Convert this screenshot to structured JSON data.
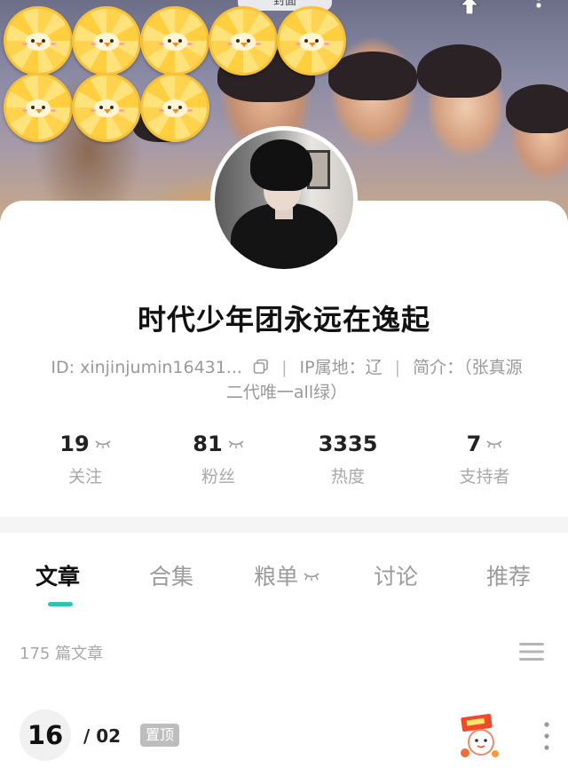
{
  "cover": {
    "tag_label": "封面",
    "candies": [
      {
        "id": "c1"
      },
      {
        "id": "c2"
      },
      {
        "id": "c3"
      },
      {
        "id": "c4"
      },
      {
        "id": "c5"
      },
      {
        "id": "c6"
      },
      {
        "id": "c7"
      },
      {
        "id": "c8"
      }
    ],
    "icons": [
      "share-icon",
      "more-vertical-icon"
    ]
  },
  "profile": {
    "name": "时代少年团永远在逸起",
    "id_label": "ID: xinjinjumin16431...",
    "ip_label": "IP属地：辽",
    "bio_label": "简介：（张真源",
    "bio_line2": "二代唯一all绿）",
    "separator": "|"
  },
  "stats": [
    {
      "value": "19",
      "label": "关注"
    },
    {
      "value": "81",
      "label": "粉丝"
    },
    {
      "value": "3335",
      "label": "热度"
    },
    {
      "value": "7",
      "label": "支持者"
    }
  ],
  "tabs": [
    {
      "label": "文章",
      "active": true
    },
    {
      "label": "合集",
      "active": false
    },
    {
      "label": "粮单",
      "active": false
    },
    {
      "label": "讨论",
      "active": false
    },
    {
      "label": "推荐",
      "active": false
    }
  ],
  "article_count": "175 篇文章",
  "article": {
    "day": "16",
    "month": "/ 02",
    "pin_label": "置顶"
  },
  "colors": {
    "accent": "#2ec3b8",
    "muted_text": "#9a9a9a",
    "pin_tag": "#bdbdbd"
  }
}
